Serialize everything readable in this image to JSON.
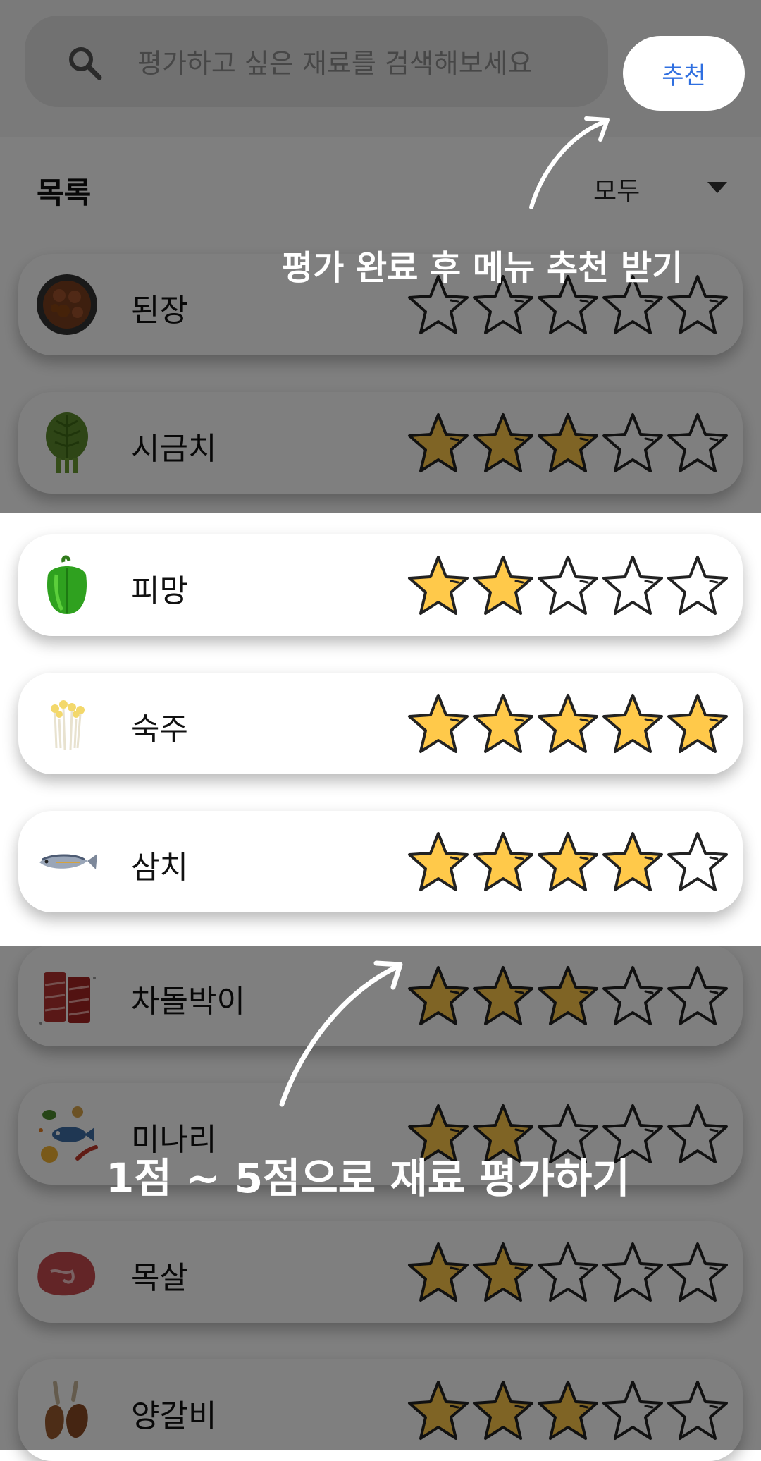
{
  "search": {
    "placeholder": "평가하고 싶은 재료를 검색해보세요"
  },
  "header": {
    "recommend_label": "추천"
  },
  "list": {
    "title": "목록",
    "filter_label": "모두"
  },
  "coach": {
    "top_hint": "평가 완료 후 메뉴 추천 받기",
    "bottom_hint": "1점 ~ 5점으로 재료 평가하기"
  },
  "colors": {
    "accent": "#2f6fe0",
    "star_fill": "#ffc94a",
    "star_stroke": "#222222",
    "dim_overlay": "rgba(0,0,0,0.5)"
  },
  "items": [
    {
      "name": "된장",
      "icon": "doenjang-icon",
      "rating": 0
    },
    {
      "name": "시금치",
      "icon": "spinach-icon",
      "rating": 3
    },
    {
      "name": "피망",
      "icon": "green-pepper-icon",
      "rating": 2
    },
    {
      "name": "숙주",
      "icon": "bean-sprouts-icon",
      "rating": 5
    },
    {
      "name": "삼치",
      "icon": "mackerel-fish-icon",
      "rating": 4
    },
    {
      "name": "차돌박이",
      "icon": "beef-brisket-icon",
      "rating": 3
    },
    {
      "name": "미나리",
      "icon": "water-parsley-icon",
      "rating": 2
    },
    {
      "name": "목살",
      "icon": "pork-neck-icon",
      "rating": 2
    },
    {
      "name": "양갈비",
      "icon": "lamb-ribs-icon",
      "rating": 3
    }
  ]
}
